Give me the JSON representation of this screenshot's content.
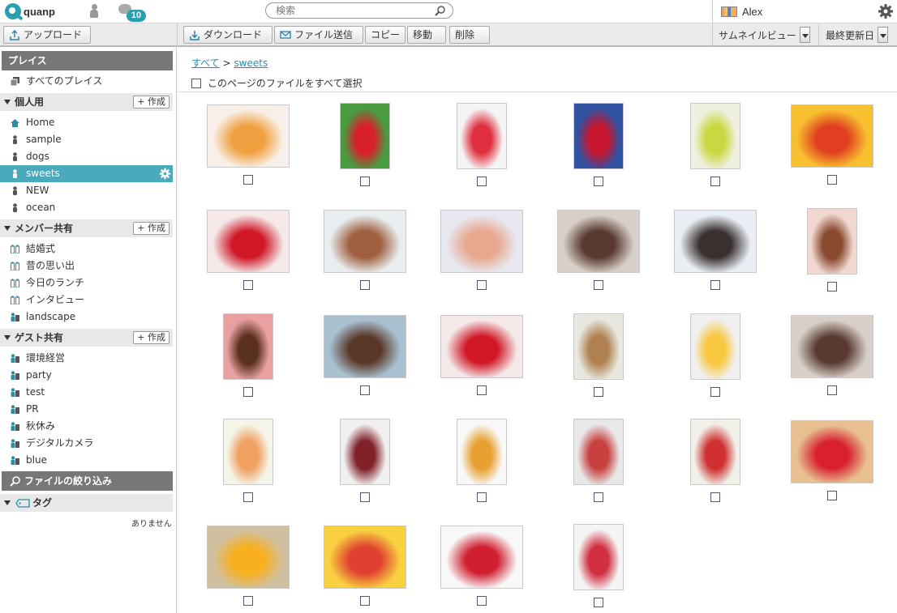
{
  "app": {
    "logo_text": "quanp",
    "chat_count": "10",
    "user_name": "Alex"
  },
  "search": {
    "placeholder": "検索"
  },
  "toolbar": {
    "upload": "アップロード",
    "download": "ダウンロード",
    "send": "ファイル送信",
    "copy": "コピー",
    "move": "移動",
    "delete": "削除",
    "view_select": "サムネイルビュー",
    "sort_select": "最終更新日"
  },
  "sidebar": {
    "places_header": "プレイス",
    "all_places": "すべてのプレイス",
    "personal": {
      "title": "個人用",
      "create": "+ 作成",
      "items": [
        "Home",
        "sample",
        "dogs",
        "sweets",
        "NEW",
        "ocean"
      ]
    },
    "member": {
      "title": "メンバー共有",
      "create": "+ 作成",
      "items": [
        "結婚式",
        "昔の思い出",
        "今日のランチ",
        "インタビュー",
        "landscape"
      ]
    },
    "guest": {
      "title": "ゲスト共有",
      "create": "+ 作成",
      "items": [
        "環境経営",
        "party",
        "test",
        "PR",
        "秋休み",
        "デジタルカメラ",
        "blue"
      ]
    },
    "filter_header": "ファイルの絞り込み",
    "tags_title": "タグ",
    "no_tags": "ありません"
  },
  "breadcrumb": {
    "root": "すべて",
    "sep": ">",
    "current": "sweets"
  },
  "select_all_label": "このページのファイルをすべて選択",
  "colors": {
    "accent": "#4aa9ba",
    "header_gray": "#777777"
  },
  "thumbnails": [
    {
      "name": "jelly-dessert",
      "c1": "#f0a040",
      "c2": "#f8f0e8"
    },
    {
      "name": "strawberries",
      "c1": "#d8202a",
      "c2": "#4a9a40"
    },
    {
      "name": "candies",
      "c1": "#e03040",
      "c2": "#f4f4f4"
    },
    {
      "name": "berry-cup",
      "c1": "#c81830",
      "c2": "#3050a0"
    },
    {
      "name": "lime-slices",
      "c1": "#c8d840",
      "c2": "#f0f0e0"
    },
    {
      "name": "fruit-assortment",
      "c1": "#e04020",
      "c2": "#f8c030"
    },
    {
      "name": "heart-chocolates",
      "c1": "#d01828",
      "c2": "#f4e8e8"
    },
    {
      "name": "cookies",
      "c1": "#a06040",
      "c2": "#e8eef0"
    },
    {
      "name": "macarons",
      "c1": "#e8a890",
      "c2": "#e8e8f0"
    },
    {
      "name": "chocolate-cakes",
      "c1": "#5a3a30",
      "c2": "#d8d0c8"
    },
    {
      "name": "truffles",
      "c1": "#3a3030",
      "c2": "#e8eef4"
    },
    {
      "name": "chocolate-discs",
      "c1": "#8a4a30",
      "c2": "#f0d8d0"
    },
    {
      "name": "chocolate-tower",
      "c1": "#5a3020",
      "c2": "#e8a0a0"
    },
    {
      "name": "heart-cookie",
      "c1": "#5a3828",
      "c2": "#a8c0d0"
    },
    {
      "name": "heart-chocolates-2",
      "c1": "#d01828",
      "c2": "#f4e8e8"
    },
    {
      "name": "cream-pastry",
      "c1": "#b08050",
      "c2": "#e8e8e0"
    },
    {
      "name": "cheesecake",
      "c1": "#f8c840",
      "c2": "#f0f0f0"
    },
    {
      "name": "chocolate-cakes-2",
      "c1": "#5a3a30",
      "c2": "#d8d0c8"
    },
    {
      "name": "fruit-drink",
      "c1": "#f0a060",
      "c2": "#f4f4e8"
    },
    {
      "name": "cream-cup",
      "c1": "#802028",
      "c2": "#f0f0f0"
    },
    {
      "name": "lemon-tea",
      "c1": "#e8a030",
      "c2": "#f8f8f8"
    },
    {
      "name": "berry-parfait",
      "c1": "#c84040",
      "c2": "#e8e8e8"
    },
    {
      "name": "tea-apples",
      "c1": "#d03030",
      "c2": "#f0f0e8"
    },
    {
      "name": "strawberry-tart",
      "c1": "#d82030",
      "c2": "#e8c090"
    },
    {
      "name": "mango-tart",
      "c1": "#f8b020",
      "c2": "#d0c0a0"
    },
    {
      "name": "fruit-tart",
      "c1": "#e04030",
      "c2": "#f8d040"
    },
    {
      "name": "berry-cake",
      "c1": "#d02030",
      "c2": "#f8f8f8"
    },
    {
      "name": "fruit-cup",
      "c1": "#d03040",
      "c2": "#f4f4f4"
    }
  ]
}
